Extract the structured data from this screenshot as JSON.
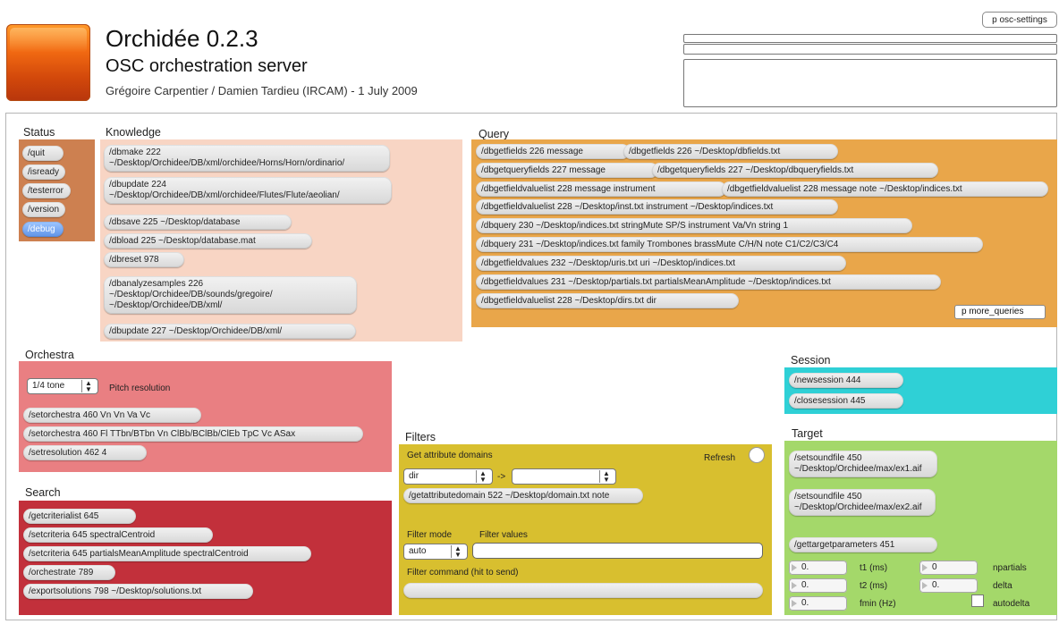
{
  "header": {
    "title": "Orchidée 0.2.3",
    "subtitle": "OSC orchestration server",
    "credit": "Grégoire Carpentier / Damien Tardieu (IRCAM) - 1 July 2009",
    "osc_settings": "p osc-settings"
  },
  "colors": {
    "status": "#cd8050",
    "knowledge": "#f8d5c4",
    "query": "#e9a64a",
    "orchestra": "#e97f82",
    "search": "#c2303b",
    "filters": "#d8bf2f",
    "session": "#2fd0d6",
    "target": "#a4d86a"
  },
  "status": {
    "label": "Status",
    "items": [
      "/quit",
      "/isready",
      "/testerror",
      "/version",
      "/debug"
    ]
  },
  "knowledge": {
    "label": "Knowledge",
    "items": [
      "/dbmake 222 ~/Desktop/Orchidee/DB/xml/orchidee/Horns/Horn/ordinario/",
      "/dbupdate 224 ~/Desktop/Orchidee/DB/xml/orchidee/Flutes/Flute/aeolian/",
      "/dbsave 225 ~/Desktop/database",
      "/dbload 225 ~/Desktop/database.mat",
      "/dbreset 978",
      "/dbanalyzesamples 226 ~/Desktop/Orchidee/DB/sounds/gregoire/ ~/Desktop/Orchidee/DB/xml/",
      "/dbupdate 227 ~/Desktop/Orchidee/DB/xml/"
    ]
  },
  "query": {
    "label": "Query",
    "items": [
      "/dbgetfields 226 message",
      "/dbgetfields 226 ~/Desktop/dbfields.txt",
      "/dbgetqueryfields 227 message",
      "/dbgetqueryfields 227 ~/Desktop/dbqueryfields.txt",
      "/dbgetfieldvaluelist 228 message instrument",
      "/dbgetfieldvaluelist 228 message note ~/Desktop/indices.txt",
      "/dbgetfieldvaluelist 228 ~/Desktop/inst.txt instrument ~/Desktop/indices.txt",
      "/dbquery 230 ~/Desktop/indices.txt stringMute SP/S instrument Va/Vn string 1",
      "/dbquery 231 ~/Desktop/indices.txt family Trombones brassMute C/H/N note C1/C2/C3/C4",
      "/dbgetfieldvalues 232 ~/Desktop/uris.txt uri ~/Desktop/indices.txt",
      "/dbgetfieldvalues 231 ~/Desktop/partials.txt partialsMeanAmplitude ~/Desktop/indices.txt",
      "/dbgetfieldvaluelist 228 ~/Desktop/dirs.txt dir"
    ],
    "more": "p more_queries"
  },
  "orchestra": {
    "label": "Orchestra",
    "pitch_value": "1/4 tone",
    "pitch_label": "Pitch resolution",
    "items": [
      "/setorchestra 460 Vn Vn Va Vc",
      "/setorchestra 460 Fl TTbn/BTbn Vn ClBb/BClBb/ClEb TpC Vc ASax",
      "/setresolution 462 4"
    ]
  },
  "search": {
    "label": "Search",
    "items": [
      "/getcriterialist 645",
      "/setcriteria 645 spectralCentroid",
      "/setcriteria 645 partialsMeanAmplitude spectralCentroid",
      "/orchestrate 789",
      "/exportsolutions 798 ~/Desktop/solutions.txt"
    ]
  },
  "filters": {
    "label": "Filters",
    "get_domains": "Get attribute domains",
    "refresh": "Refresh",
    "attr_select": "dir",
    "arrow": "->",
    "domain_msg": "/getattributedomain 522 ~/Desktop/domain.txt note",
    "filter_mode_label": "Filter mode",
    "filter_values_label": "Filter values",
    "mode_value": "auto",
    "command_label": "Filter command (hit to send)"
  },
  "session": {
    "label": "Session",
    "items": [
      "/newsession 444",
      "/closesession 445"
    ]
  },
  "target": {
    "label": "Target",
    "items": [
      "/setsoundfile 450 ~/Desktop/Orchidee/max/ex1.aif",
      "/setsoundfile 450 ~/Desktop/Orchidee/max/ex2.aif",
      "/gettargetparameters 451"
    ],
    "t1_value": "0.",
    "t1_label": "t1 (ms)",
    "t2_value": "0.",
    "t2_label": "t2 (ms)",
    "fmin_value": "0.",
    "fmin_label": "fmin (Hz)",
    "npartials_value": "0",
    "npartials_label": "npartials",
    "delta_value": "0.",
    "delta_label": "delta",
    "autodelta_label": "autodelta"
  }
}
